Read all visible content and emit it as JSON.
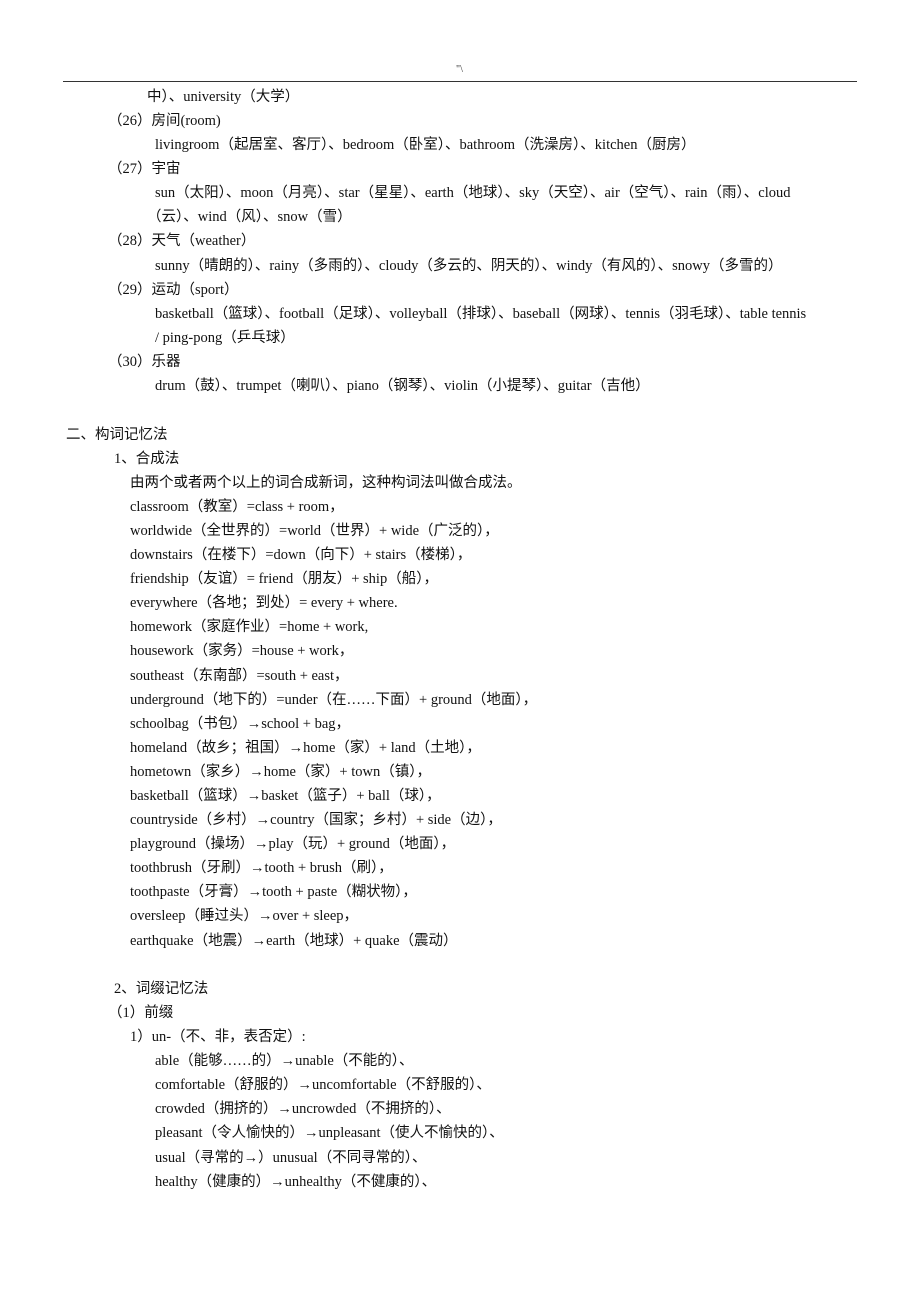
{
  "header": {
    "mark": "\"\\"
  },
  "vocab_continued": {
    "line": "中）、university（大学）"
  },
  "categories": [
    {
      "label": "（26）房间(room)",
      "lines": [
        "livingroom（起居室、客厅）、bedroom（卧室）、bathroom（洗澡房）、kitchen（厨房）"
      ]
    },
    {
      "label": "（27）宇宙",
      "lines": [
        "sun（太阳）、moon（月亮）、star（星星）、earth（地球）、sky（天空）、air（空气）、rain（雨）、cloud",
        "（云）、wind（风）、snow（雪）"
      ]
    },
    {
      "label": "（28）天气（weather）",
      "lines": [
        "sunny（晴朗的）、rainy（多雨的）、cloudy（多云的、阴天的）、windy（有风的）、snowy（多雪的）"
      ]
    },
    {
      "label": "（29）运动（sport）",
      "lines": [
        "basketball（篮球）、football（足球）、volleyball（排球）、baseball（网球）、tennis（羽毛球）、table tennis",
        "/ ping-pong（乒乓球）"
      ]
    },
    {
      "label": "（30）乐器",
      "lines": [
        "drum（鼓）、trumpet（喇叭）、piano（钢琴）、violin（小提琴）、guitar（吉他）"
      ]
    }
  ],
  "section2": {
    "title": "二、构词记忆法",
    "compound": {
      "title": "1、合成法",
      "intro": "由两个或者两个以上的词合成新词，这种构词法叫做合成法。",
      "examples": [
        "classroom（教室）=class + room，",
        "worldwide（全世界的）=world（世界）+ wide（广泛的），",
        "downstairs（在楼下）=down（向下）+ stairs（楼梯），",
        "friendship（友谊）= friend（朋友）+ ship（船），",
        "everywhere（各地；到处）= every + where.",
        "homework（家庭作业）=home + work,",
        "housework（家务）=house + work，",
        "southeast（东南部）=south + east，",
        "underground（地下的）=under（在……下面）+ ground（地面），",
        "schoolbag（书包）→school + bag，",
        "homeland（故乡；祖国）→home（家）+ land（土地），",
        "hometown（家乡）→home（家）+ town（镇），",
        "basketball（篮球）→basket（篮子）+ ball（球），",
        "countryside（乡村）→country（国家；乡村）+ side（边），",
        "playground（操场）→play（玩）+ ground（地面），",
        "toothbrush（牙刷）→tooth + brush（刷），",
        "toothpaste（牙膏）→tooth + paste（糊状物），",
        "oversleep（睡过头）→over + sleep，",
        "earthquake（地震）→earth（地球）+ quake（震动）"
      ]
    },
    "affix": {
      "title": "2、词缀记忆法",
      "prefix_title": "（1）前缀",
      "un_title": "1）un-（不、非，表否定）:",
      "examples": [
        "able（能够……的）→unable（不能的）、",
        "comfortable（舒服的）→uncomfortable（不舒服的）、",
        "crowded（拥挤的）→uncrowded（不拥挤的）、",
        "pleasant（令人愉快的）→unpleasant（使人不愉快的）、",
        "usual（寻常的→）unusual（不同寻常的）、",
        "healthy（健康的）→unhealthy（不健康的）、"
      ]
    }
  }
}
